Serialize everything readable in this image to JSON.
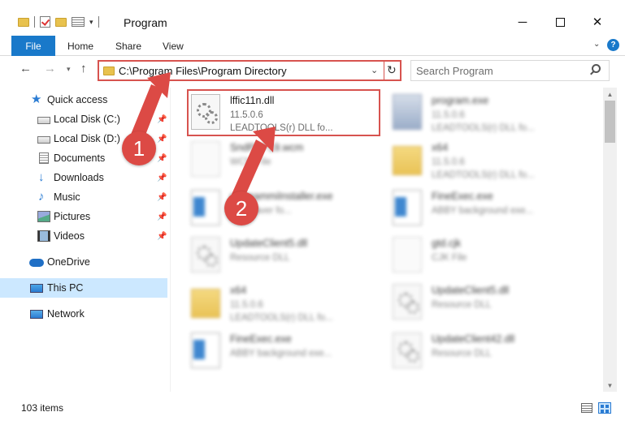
{
  "window": {
    "title": "Program"
  },
  "ribbon": {
    "file_label": "File",
    "tabs": [
      "Home",
      "Share",
      "View"
    ]
  },
  "address": {
    "path": "C:\\Program Files\\Program Directory",
    "search_placeholder": "Search Program"
  },
  "sidebar": {
    "items": [
      {
        "label": "Quick access",
        "icon": "star-icon"
      },
      {
        "label": "Local Disk (C:)",
        "icon": "drive-icon"
      },
      {
        "label": "Local Disk (D:)",
        "icon": "drive-icon"
      },
      {
        "label": "Documents",
        "icon": "documents-icon"
      },
      {
        "label": "Downloads",
        "icon": "download-icon"
      },
      {
        "label": "Music",
        "icon": "music-icon"
      },
      {
        "label": "Pictures",
        "icon": "pictures-icon"
      },
      {
        "label": "Videos",
        "icon": "videos-icon"
      },
      {
        "label": "OneDrive",
        "icon": "cloud-icon"
      },
      {
        "label": "This PC",
        "icon": "computer-icon"
      },
      {
        "label": "Network",
        "icon": "network-icon"
      }
    ]
  },
  "files": [
    {
      "name": "lffic11n.dll",
      "line1": "11.5.0.6",
      "line2": "LEADTOOLS(r) DLL fo...",
      "type": "dll",
      "highlighted": true
    },
    {
      "name": "program.exe",
      "line1": "11.5.0.6",
      "line2": "LEADTOOLS(r) DLL fo...",
      "type": "install"
    },
    {
      "name": "SndPPP19.wcm",
      "line1": "WCM File",
      "line2": "",
      "type": "blank"
    },
    {
      "name": "x64",
      "line1": "11.5.0.6",
      "line2": "LEADTOOLS(r) DLL fo...",
      "type": "folder"
    },
    {
      "name": "programmiInstaller.exe",
      "line1": "Timesaver fo...",
      "line2": "",
      "type": "exe"
    },
    {
      "name": "FineExec.exe",
      "line1": "ABBY background exe...",
      "line2": "",
      "type": "exe"
    },
    {
      "name": "UpdateClient5.dll",
      "line1": "Resource DLL",
      "line2": "",
      "type": "dll"
    },
    {
      "name": "gtd.cjk",
      "line1": "CJK File",
      "line2": "",
      "type": "blank"
    },
    {
      "name": "x64",
      "line1": "11.5.0.6",
      "line2": "LEADTOOLS(r) DLL fo...",
      "type": "folder"
    },
    {
      "name": "UpdateClient5.dll",
      "line1": "Resource DLL",
      "line2": "",
      "type": "dll"
    },
    {
      "name": "FineExec.exe",
      "line1": "ABBY background exe...",
      "line2": "",
      "type": "exe"
    },
    {
      "name": "UpdateClient42.dll",
      "line1": "Resource DLL",
      "line2": "",
      "type": "dll"
    }
  ],
  "status": {
    "item_count": "103 items"
  },
  "annotations": {
    "step1": "1",
    "step2": "2",
    "color": "#dc4a45"
  }
}
